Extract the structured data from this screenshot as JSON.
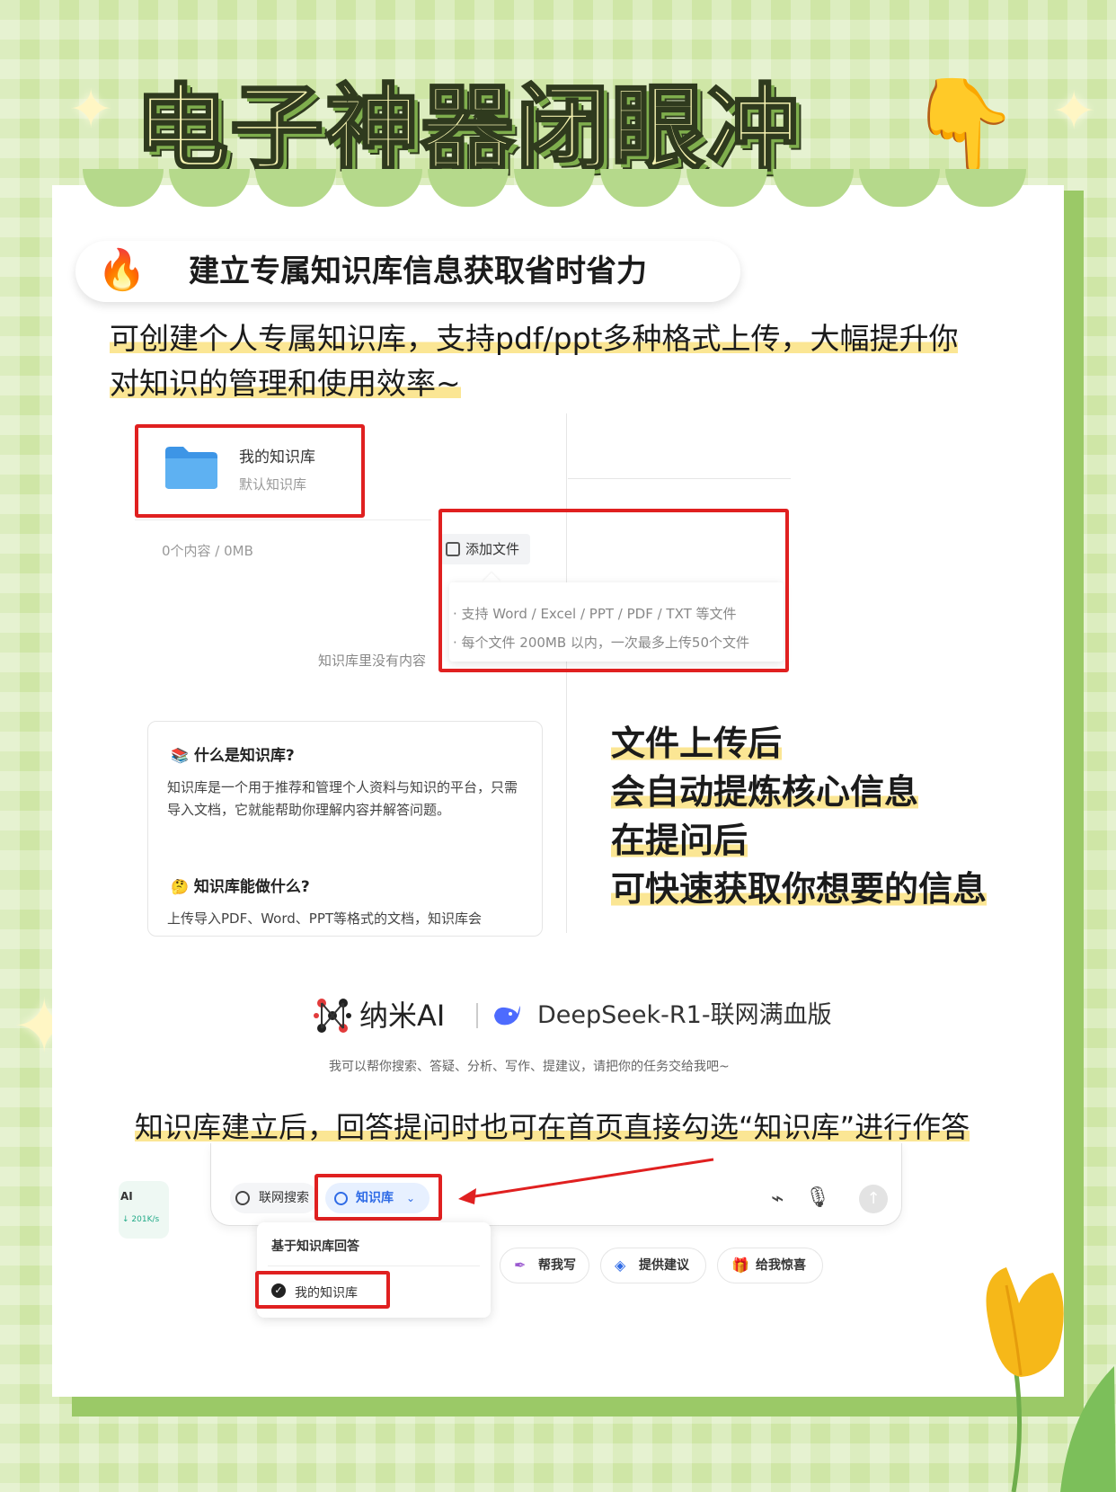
{
  "title": "电子神器闭眼冲",
  "section": {
    "title": "建立专属知识库信息获取省时省力"
  },
  "intro": {
    "line1": "可创建个人专属知识库，支持pdf/ppt多种格式上传，大幅提升你",
    "line2": "对知识的管理和使用效率~"
  },
  "kb_panel": {
    "name": "我的知识库",
    "subtitle": "默认知识库",
    "counts": "0个内容 / 0MB",
    "add_button": "添加文件",
    "tip_formats": "· 支持 Word / Excel / PPT / PDF / TXT 等文件",
    "tip_limits": "· 每个文件 200MB 以内，一次最多上传50个文件",
    "empty_text": "知识库里没有内容"
  },
  "info_card": {
    "q1": "什么是知识库?",
    "a1": "知识库是一个用于推荐和管理个人资料与知识的平台，只需导入文档，它就能帮助你理解内容并解答问题。",
    "q2": "知识库能做什么?",
    "a2": "上传导入PDF、Word、PPT等格式的文档，知识库会"
  },
  "features": [
    "文件上传后",
    "会自动提炼核心信息",
    "在提问后",
    "可快速获取你想要的信息"
  ],
  "brand": {
    "name": "纳米AI",
    "model": "DeepSeek-R1-联网满血版",
    "description": "我可以帮你搜索、答疑、分析、写作、提建议，请把你的任务交给我吧~"
  },
  "note": "知识库建立后，回答提问时也可在首页直接勾选“知识库”进行作答",
  "composer": {
    "side_label": "AI",
    "side_speed": "↓ 201K/s",
    "web_search": "联网搜索",
    "kb_chip": "知识库",
    "dropdown_title": "基于知识库回答",
    "dropdown_item": "我的知识库"
  },
  "suggestions": [
    "帮我写",
    "提供建议",
    "给我惊喜"
  ],
  "colors": {
    "background": "#cfe6a6",
    "highlight": "#fbe694",
    "annotation_red": "#e02020",
    "accent_blue": "#2f6be6"
  }
}
